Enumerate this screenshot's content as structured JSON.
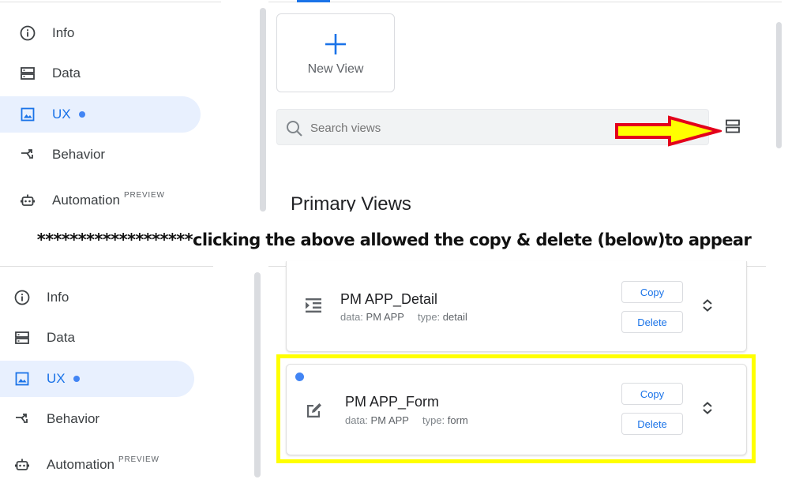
{
  "top_panel": {
    "nav": [
      {
        "label": "Info",
        "icon": "info-icon"
      },
      {
        "label": "Data",
        "icon": "data-icon"
      },
      {
        "label": "UX",
        "icon": "ux-icon",
        "active": true
      },
      {
        "label": "Behavior",
        "icon": "behavior-icon"
      },
      {
        "label": "Automation",
        "icon": "automation-icon",
        "badge": "PREVIEW"
      }
    ],
    "new_view_label": "New View",
    "search_placeholder": "Search views",
    "section_heading": "Primary Views"
  },
  "annotation_text": "*******************clicking the above allowed the copy & delete (below)to appear",
  "bottom_panel": {
    "nav": [
      {
        "label": "Info",
        "icon": "info-icon"
      },
      {
        "label": "Data",
        "icon": "data-icon"
      },
      {
        "label": "UX",
        "icon": "ux-icon",
        "active": true
      },
      {
        "label": "Behavior",
        "icon": "behavior-icon"
      },
      {
        "label": "Automation",
        "icon": "automation-icon",
        "badge": "PREVIEW"
      }
    ],
    "views": [
      {
        "name": "PM APP_Detail",
        "data_label": "data:",
        "data_value": "PM APP",
        "type_label": "type:",
        "type_value": "detail",
        "copy_label": "Copy",
        "delete_label": "Delete",
        "icon": "detail-view-icon"
      },
      {
        "name": "PM APP_Form",
        "data_label": "data:",
        "data_value": "PM APP",
        "type_label": "type:",
        "type_value": "form",
        "copy_label": "Copy",
        "delete_label": "Delete",
        "icon": "form-edit-icon"
      }
    ]
  },
  "colors": {
    "accent": "#1a73e8",
    "active_bg": "#e8f0fe",
    "arrow_fill": "#ffff00",
    "arrow_outline": "#e3001b",
    "highlight_box": "#ffff00"
  }
}
